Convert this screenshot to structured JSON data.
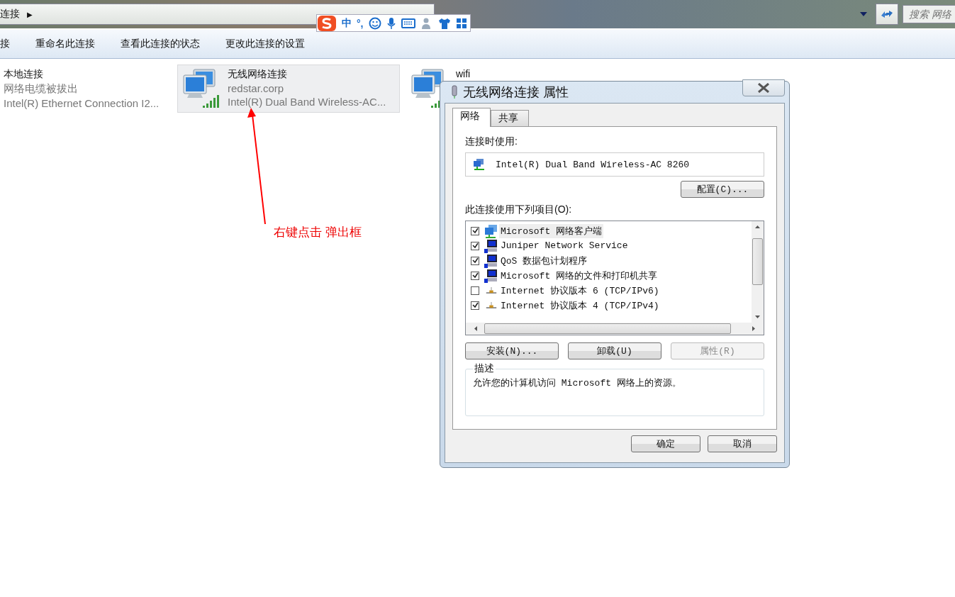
{
  "address_bar": {
    "breadcrumb": "连接",
    "arrow": "▶",
    "search": {
      "placeholder": "搜索 网络"
    }
  },
  "ime_toolbar": {
    "mode": "中",
    "punctuation": "°,"
  },
  "toolbar": {
    "items": [
      "接",
      "重命名此连接",
      "查看此连接的状态",
      "更改此连接的设置"
    ]
  },
  "connections": [
    {
      "name": "本地连接",
      "status": "网络电缆被拔出",
      "adapter": "Intel(R) Ethernet Connection I2...",
      "kind": "wired",
      "selected": false
    },
    {
      "name": "无线网络连接",
      "status": "redstar.corp",
      "adapter": "Intel(R) Dual Band Wireless-AC...",
      "kind": "wireless",
      "selected": true
    },
    {
      "name": "wifi",
      "kind": "wireless",
      "selected": false
    }
  ],
  "annotation": {
    "text": "右键点击 弹出框"
  },
  "dialog": {
    "title": "无线网络连接 属性",
    "tabs": [
      {
        "label": "网络",
        "selected": true
      },
      {
        "label": "共享",
        "selected": false
      }
    ],
    "connect_using_label": "连接时使用:",
    "adapter": "Intel(R) Dual Band Wireless-AC 8260",
    "configure_button": "配置(C)...",
    "items_label": "此连接使用下列项目(O):",
    "items": [
      {
        "label": "Microsoft 网络客户端",
        "checked": true,
        "kind": "client",
        "selected": true
      },
      {
        "label": "Juniper Network Service",
        "checked": true,
        "kind": "service",
        "selected": false
      },
      {
        "label": "QoS 数据包计划程序",
        "checked": true,
        "kind": "service",
        "selected": false
      },
      {
        "label": "Microsoft 网络的文件和打印机共享",
        "checked": true,
        "kind": "service",
        "selected": false
      },
      {
        "label": "Internet 协议版本 6 (TCP/IPv6)",
        "checked": false,
        "kind": "protocol",
        "selected": false
      },
      {
        "label": "Internet 协议版本 4 (TCP/IPv4)",
        "checked": true,
        "kind": "protocol",
        "selected": false
      }
    ],
    "item_buttons": [
      {
        "label": "安装(N)...",
        "disabled": false
      },
      {
        "label": "卸载(U)",
        "disabled": false
      },
      {
        "label": "属性(R)",
        "disabled": true
      }
    ],
    "description": {
      "legend": "描述",
      "text": "允许您的计算机访问 Microsoft 网络上的资源。"
    },
    "footer_buttons": [
      "确定",
      "取消"
    ]
  }
}
